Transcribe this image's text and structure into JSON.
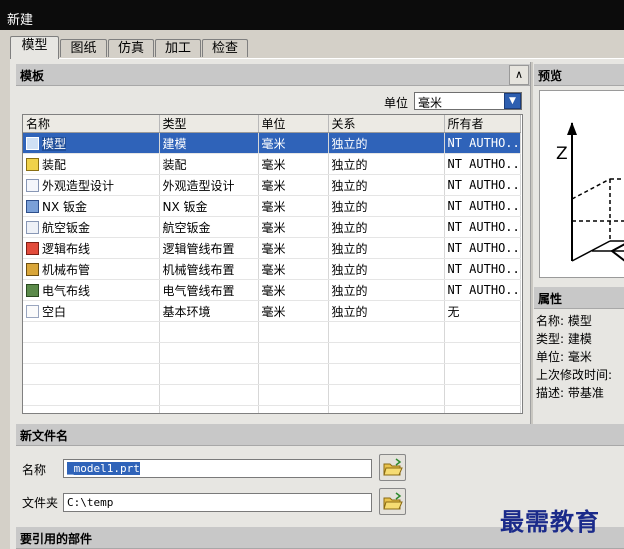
{
  "window": {
    "title": "新建"
  },
  "tabs": [
    {
      "label": "模型",
      "active": true
    },
    {
      "label": "图纸",
      "active": false
    },
    {
      "label": "仿真",
      "active": false
    },
    {
      "label": "加工",
      "active": false
    },
    {
      "label": "检查",
      "active": false
    }
  ],
  "templates": {
    "header": "模板",
    "unit_label": "单位",
    "unit_value": "毫米",
    "columns": [
      "名称",
      "类型",
      "单位",
      "关系",
      "所有者"
    ],
    "rows": [
      {
        "icon": "model-icon",
        "name": "模型",
        "type": "建模",
        "unit": "毫米",
        "relation": "独立的",
        "owner": "NT AUTHO...",
        "selected": true
      },
      {
        "icon": "assembly-icon",
        "name": "装配",
        "type": "装配",
        "unit": "毫米",
        "relation": "独立的",
        "owner": "NT AUTHO..."
      },
      {
        "icon": "shape-studio-icon",
        "name": "外观造型设计",
        "type": "外观造型设计",
        "unit": "毫米",
        "relation": "独立的",
        "owner": "NT AUTHO..."
      },
      {
        "icon": "sheet-metal-icon",
        "name": "NX 钣金",
        "type": "NX 钣金",
        "unit": "毫米",
        "relation": "独立的",
        "owner": "NT AUTHO..."
      },
      {
        "icon": "aero-sheet-metal-icon",
        "name": "航空钣金",
        "type": "航空钣金",
        "unit": "毫米",
        "relation": "独立的",
        "owner": "NT AUTHO..."
      },
      {
        "icon": "logical-routing-icon",
        "name": "逻辑布线",
        "type": "逻辑管线布置",
        "unit": "毫米",
        "relation": "独立的",
        "owner": "NT AUTHO..."
      },
      {
        "icon": "mechanical-routing-icon",
        "name": "机械布管",
        "type": "机械管线布置",
        "unit": "毫米",
        "relation": "独立的",
        "owner": "NT AUTHO..."
      },
      {
        "icon": "electrical-routing-icon",
        "name": "电气布线",
        "type": "电气管线布置",
        "unit": "毫米",
        "relation": "独立的",
        "owner": "NT AUTHO..."
      },
      {
        "icon": "blank-icon",
        "name": "空白",
        "type": "基本环境",
        "unit": "毫米",
        "relation": "独立的",
        "owner": "无"
      }
    ]
  },
  "preview": {
    "header": "预览",
    "axis_label": "Z"
  },
  "properties": {
    "header": "属性",
    "items": [
      {
        "label": "名称:",
        "value": "模型"
      },
      {
        "label": "类型:",
        "value": "建模"
      },
      {
        "label": "单位:",
        "value": "毫米"
      },
      {
        "label": "上次修改时间:",
        "value": ""
      },
      {
        "label": "描述:",
        "value": "带基准"
      }
    ]
  },
  "new_file": {
    "header": "新文件名",
    "name_label": "名称",
    "name_value": "_model1.prt",
    "folder_label": "文件夹",
    "folder_value": "C:\\temp"
  },
  "referenced_parts": {
    "header": "要引用的部件"
  },
  "watermark": "最需教育"
}
